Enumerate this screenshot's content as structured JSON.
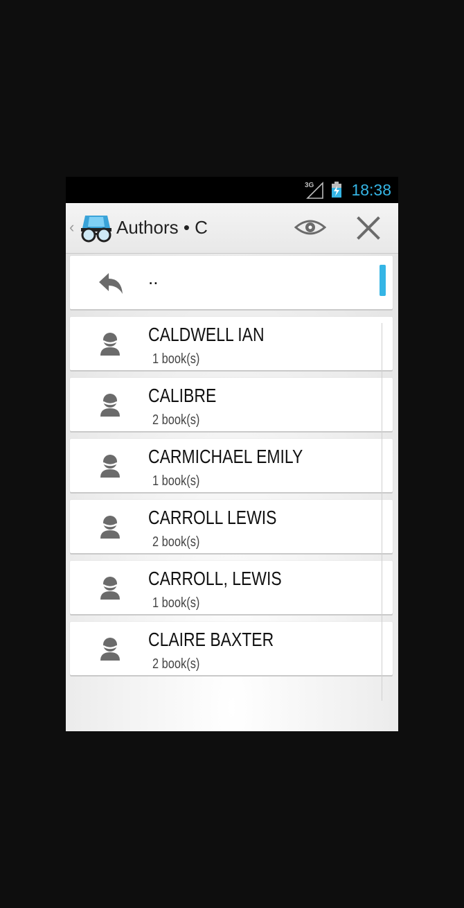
{
  "status_bar": {
    "network": "3G",
    "time": "18:38",
    "time_color": "#35b5e5"
  },
  "action_bar": {
    "title": "Authors • C",
    "up_indicator": "‹",
    "icons": [
      "app-logo-icon",
      "eye-icon",
      "close-icon"
    ]
  },
  "list": {
    "parent_item": {
      "label": "..",
      "icon": "back-arrow-icon"
    },
    "authors": [
      {
        "name": "CALDWELL IAN",
        "count": "1 book(s)"
      },
      {
        "name": "CALIBRE",
        "count": "2 book(s)"
      },
      {
        "name": "CARMICHAEL EMILY",
        "count": "1 book(s)"
      },
      {
        "name": "CARROLL LEWIS",
        "count": "2 book(s)"
      },
      {
        "name": "CARROLL, LEWIS",
        "count": "1 book(s)"
      },
      {
        "name": "CLAIRE BAXTER",
        "count": "2 book(s)"
      }
    ]
  },
  "colors": {
    "accent": "#35b5e5",
    "icon_gray": "#6b6b6b"
  }
}
